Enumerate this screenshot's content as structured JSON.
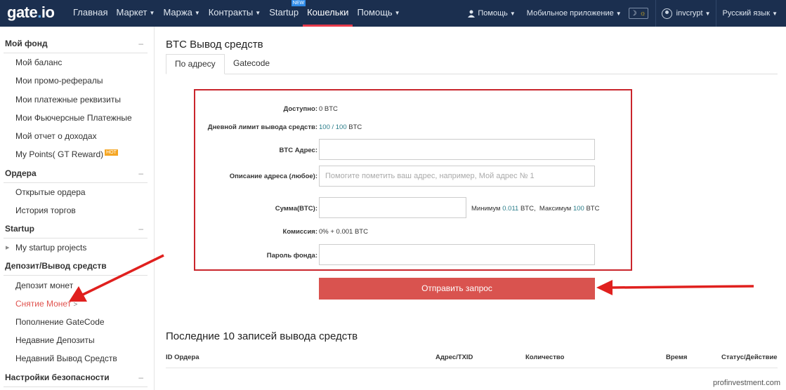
{
  "header": {
    "logo_prefix": "gate",
    "logo_dot": ".",
    "logo_suffix": "io",
    "nav": [
      "Главная",
      "Маркет",
      "Маржа",
      "Контракты",
      "Startup",
      "Кошельки",
      "Помощь"
    ],
    "new_badge": "NEW",
    "help": "Помощь",
    "mobile_app": "Мобильное приложение",
    "username": "invcrypt",
    "language": "Русский язык",
    "colors": {
      "bar": "#1b2f4f",
      "active_underline": "#e6394a"
    }
  },
  "sidebar": {
    "section_fund": "Мой фонд",
    "fund_items": [
      "Мой баланс",
      "Мои промо-рефералы",
      "Мои платежные реквизиты",
      "Мои Фьючерсные Платежные",
      "Мой отчет о доходах",
      "My Points( GT Reward)"
    ],
    "hot_badge": "HOT",
    "section_orders": "Ордера",
    "order_items": [
      "Открытые ордера",
      "История торгов"
    ],
    "section_startup": "Startup",
    "startup_items": [
      "My startup projects"
    ],
    "section_deposit": "Депозит/Вывод средств",
    "deposit_items": [
      "Депозит монет",
      "Снятие Монет",
      "Пополнение GateCode",
      "Недавние Депозиты",
      "Недавний Вывод Средств"
    ],
    "active_marker": ">",
    "section_security": "Настройки безопасности",
    "collapse_symbol": "–"
  },
  "main": {
    "title": "BTC Вывод средств",
    "tabs": [
      "По адресу",
      "Gatecode"
    ],
    "form": {
      "available_label": "Доступно:",
      "available_value": "0 BTC",
      "limit_label": "Дневной лимит вывода средств:",
      "limit_value": "100 / 100",
      "limit_unit": "BTC",
      "address_label": "BTC Адрес:",
      "desc_label": "Описание адреса (любое):",
      "desc_placeholder": "Помогите пометить ваш адрес, например, Мой адрес № 1",
      "amount_label": "Сумма(BTC):",
      "min_label": "Минимум",
      "min_value": "0.011",
      "min_unit": "BTC,",
      "max_label": "Максимум",
      "max_value": "100",
      "max_unit": "BTC",
      "fee_label": "Комиссия:",
      "fee_value": "0% + 0.001 BTC",
      "password_label": "Пароль фонда:",
      "submit": "Отправить запрос"
    },
    "history": {
      "title": "Последние 10 записей вывода средств",
      "columns": [
        "ID Ордера",
        "Адрес/TXID",
        "Количество",
        "Время",
        "Статус/Действие"
      ]
    }
  },
  "watermark": "profinvestment.com",
  "accent_colors": {
    "highlight_border": "#c9252c",
    "submit_button": "#d9534f",
    "active_link": "#e0524e",
    "annotation_arrow": "#e0201e"
  }
}
